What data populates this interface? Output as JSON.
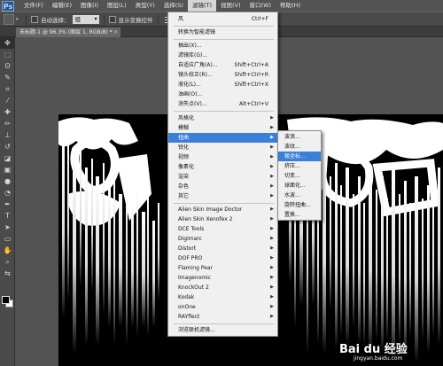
{
  "app": {
    "logo": "Ps"
  },
  "menubar": {
    "items": [
      "文件(F)",
      "编辑(E)",
      "图像(I)",
      "图层(L)",
      "类型(Y)",
      "选择(S)",
      "滤镜(T)",
      "视图(V)",
      "窗口(W)",
      "帮助(H)"
    ],
    "active_index": 6
  },
  "options": {
    "auto_select_label": "自动选择：",
    "auto_select_value": "组",
    "show_transform_label": "显示变换控件"
  },
  "document_tab": {
    "title": "未标题-1 @ 96.3% (图层 1, RGB/8) *",
    "close": "×"
  },
  "filter_menu": {
    "items": [
      {
        "label": "风",
        "shortcut": "Ctrl+F"
      },
      {
        "label": "转换为智能滤镜"
      },
      {
        "label": "抽出(X)..."
      },
      {
        "label": "滤镜库(G)..."
      },
      {
        "label": "自适应广角(A)...",
        "shortcut": "Shift+Ctrl+A"
      },
      {
        "label": "镜头校正(R)...",
        "shortcut": "Shift+Ctrl+R"
      },
      {
        "label": "液化(L)...",
        "shortcut": "Shift+Ctrl+X"
      },
      {
        "label": "油画(O)..."
      },
      {
        "label": "消失点(V)...",
        "shortcut": "Alt+Ctrl+V"
      },
      {
        "label": "风格化"
      },
      {
        "label": "模糊"
      },
      {
        "label": "扭曲"
      },
      {
        "label": "锐化"
      },
      {
        "label": "视频"
      },
      {
        "label": "像素化"
      },
      {
        "label": "渲染"
      },
      {
        "label": "杂色"
      },
      {
        "label": "其它"
      },
      {
        "label": "Alien Skin Image Doctor"
      },
      {
        "label": "Alien Skin Xenofex 2"
      },
      {
        "label": "DCE Tools"
      },
      {
        "label": "Digimarc"
      },
      {
        "label": "Distort"
      },
      {
        "label": "DOF PRO"
      },
      {
        "label": "Flaming Pear"
      },
      {
        "label": "Imagenomic"
      },
      {
        "label": "KnockOut 2"
      },
      {
        "label": "Kodak"
      },
      {
        "label": "onOne"
      },
      {
        "label": "RAYflect"
      },
      {
        "label": "浏览联机滤镜..."
      }
    ]
  },
  "distort_submenu": {
    "items": [
      "波浪...",
      "波纹...",
      "极坐标...",
      "挤压...",
      "切变...",
      "球面化...",
      "水波...",
      "旋转扭曲...",
      "置换..."
    ]
  },
  "watermark": {
    "brand": "Bai du 经验",
    "url": "jingyan.baidu.com"
  }
}
